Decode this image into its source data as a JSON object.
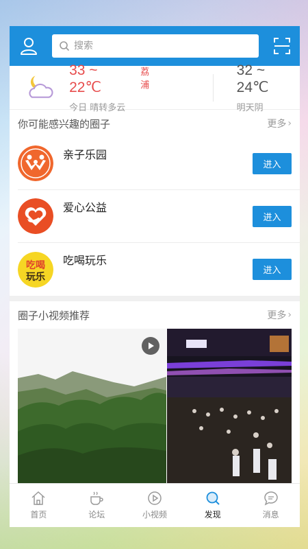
{
  "search": {
    "placeholder": "搜索"
  },
  "weather": {
    "today_temp": "33 ~ 22℃",
    "city": "荔浦",
    "today_condition": "今日 晴转多云",
    "tomorrow_temp": "32 ~ 24℃",
    "tomorrow_condition": "明天阴"
  },
  "circles": {
    "title": "你可能感兴趣的圈子",
    "more": "更多",
    "items": [
      {
        "name": "亲子乐园",
        "button": "进入",
        "logo": "family-logo-icon"
      },
      {
        "name": "爱心公益",
        "button": "进入",
        "logo": "heart-hand-logo-icon"
      },
      {
        "name": "吃喝玩乐",
        "button": "进入",
        "logo": "eat-drink-logo-icon",
        "logo_text": [
          "吃喝",
          "玩乐"
        ]
      }
    ]
  },
  "videos": {
    "title": "圈子小视频推荐",
    "more": "更多"
  },
  "tabbar": {
    "items": [
      {
        "label": "首页",
        "icon": "home-icon"
      },
      {
        "label": "论坛",
        "icon": "coffee-cup-icon"
      },
      {
        "label": "小视频",
        "icon": "video-play-icon"
      },
      {
        "label": "发现",
        "icon": "discover-search-icon",
        "active": true
      },
      {
        "label": "消息",
        "icon": "message-bubble-icon"
      }
    ]
  },
  "colors": {
    "primary": "#1d8fdc",
    "temp_today": "#e74c4c"
  }
}
